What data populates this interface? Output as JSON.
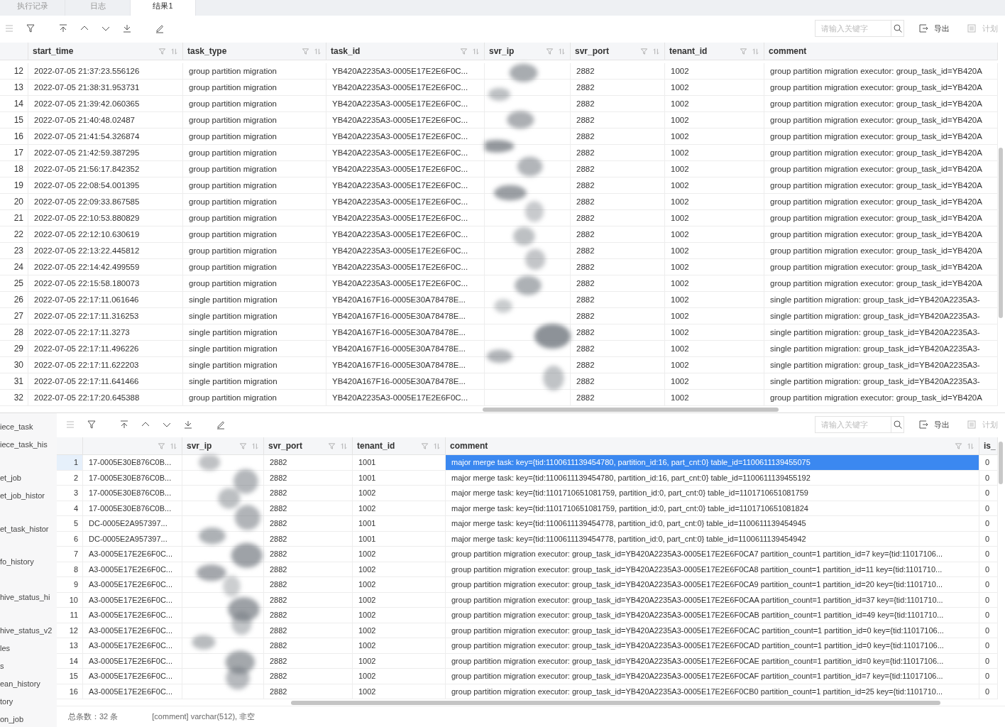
{
  "tabs": [
    {
      "label": "执行记录",
      "selected": false
    },
    {
      "label": "日志",
      "selected": false
    },
    {
      "label": "结果1",
      "selected": true
    }
  ],
  "toolbar": {
    "search_placeholder": "请输入关键字",
    "export_label": "导出",
    "plan_label": "计划",
    "plan_disabled": true
  },
  "result_table": {
    "columns": [
      {
        "label": "start_time",
        "controls": true
      },
      {
        "label": "task_type",
        "controls": true
      },
      {
        "label": "task_id",
        "controls": true
      },
      {
        "label": "svr_ip",
        "controls": true
      },
      {
        "label": "svr_port",
        "controls": true
      },
      {
        "label": "tenant_id",
        "controls": true
      },
      {
        "label": "comment",
        "controls": false
      }
    ],
    "rows": [
      {
        "n": "12",
        "cells": [
          "2022-07-05 21:37:23.556126",
          "group partition migration",
          "YB420A2235A3-0005E17E2E6F0C...",
          "",
          "2882",
          "1002",
          "group partition migration executor: group_task_id=YB420A"
        ]
      },
      {
        "n": "13",
        "cells": [
          "2022-07-05 21:38:31.953731",
          "group partition migration",
          "YB420A2235A3-0005E17E2E6F0C...",
          "",
          "2882",
          "1002",
          "group partition migration executor: group_task_id=YB420A"
        ]
      },
      {
        "n": "14",
        "cells": [
          "2022-07-05 21:39:42.060365",
          "group partition migration",
          "YB420A2235A3-0005E17E2E6F0C...",
          "",
          "2882",
          "1002",
          "group partition migration executor: group_task_id=YB420A"
        ]
      },
      {
        "n": "15",
        "cells": [
          "2022-07-05 21:40:48.02487",
          "group partition migration",
          "YB420A2235A3-0005E17E2E6F0C...",
          "",
          "2882",
          "1002",
          "group partition migration executor: group_task_id=YB420A"
        ]
      },
      {
        "n": "16",
        "cells": [
          "2022-07-05 21:41:54.326874",
          "group partition migration",
          "YB420A2235A3-0005E17E2E6F0C...",
          "",
          "2882",
          "1002",
          "group partition migration executor: group_task_id=YB420A"
        ]
      },
      {
        "n": "17",
        "cells": [
          "2022-07-05 21:42:59.387295",
          "group partition migration",
          "YB420A2235A3-0005E17E2E6F0C...",
          "",
          "2882",
          "1002",
          "group partition migration executor: group_task_id=YB420A"
        ]
      },
      {
        "n": "18",
        "cells": [
          "2022-07-05 21:56:17.842352",
          "group partition migration",
          "YB420A2235A3-0005E17E2E6F0C...",
          "",
          "2882",
          "1002",
          "group partition migration executor: group_task_id=YB420A"
        ]
      },
      {
        "n": "19",
        "cells": [
          "2022-07-05 22:08:54.001395",
          "group partition migration",
          "YB420A2235A3-0005E17E2E6F0C...",
          "",
          "2882",
          "1002",
          "group partition migration executor: group_task_id=YB420A"
        ]
      },
      {
        "n": "20",
        "cells": [
          "2022-07-05 22:09:33.867585",
          "group partition migration",
          "YB420A2235A3-0005E17E2E6F0C...",
          "",
          "2882",
          "1002",
          "group partition migration executor: group_task_id=YB420A"
        ]
      },
      {
        "n": "21",
        "cells": [
          "2022-07-05 22:10:53.880829",
          "group partition migration",
          "YB420A2235A3-0005E17E2E6F0C...",
          "",
          "2882",
          "1002",
          "group partition migration executor: group_task_id=YB420A"
        ]
      },
      {
        "n": "22",
        "cells": [
          "2022-07-05 22:12:10.630619",
          "group partition migration",
          "YB420A2235A3-0005E17E2E6F0C...",
          "",
          "2882",
          "1002",
          "group partition migration executor: group_task_id=YB420A"
        ]
      },
      {
        "n": "23",
        "cells": [
          "2022-07-05 22:13:22.445812",
          "group partition migration",
          "YB420A2235A3-0005E17E2E6F0C...",
          "",
          "2882",
          "1002",
          "group partition migration executor: group_task_id=YB420A"
        ]
      },
      {
        "n": "24",
        "cells": [
          "2022-07-05 22:14:42.499559",
          "group partition migration",
          "YB420A2235A3-0005E17E2E6F0C...",
          "",
          "2882",
          "1002",
          "group partition migration executor: group_task_id=YB420A"
        ]
      },
      {
        "n": "25",
        "cells": [
          "2022-07-05 22:15:58.180073",
          "group partition migration",
          "YB420A2235A3-0005E17E2E6F0C...",
          "",
          "2882",
          "1002",
          "group partition migration executor: group_task_id=YB420A"
        ]
      },
      {
        "n": "26",
        "cells": [
          "2022-07-05 22:17:11.061646",
          "single partition migration",
          "YB420A167F16-0005E30A78478E...",
          "",
          "2882",
          "1002",
          "single partition migration: group_task_id=YB420A2235A3-"
        ]
      },
      {
        "n": "27",
        "cells": [
          "2022-07-05 22:17:11.316253",
          "single partition migration",
          "YB420A167F16-0005E30A78478E...",
          "",
          "2882",
          "1002",
          "single partition migration: group_task_id=YB420A2235A3-"
        ]
      },
      {
        "n": "28",
        "cells": [
          "2022-07-05 22:17:11.3273",
          "single partition migration",
          "YB420A167F16-0005E30A78478E...",
          "",
          "2882",
          "1002",
          "single partition migration: group_task_id=YB420A2235A3-"
        ]
      },
      {
        "n": "29",
        "cells": [
          "2022-07-05 22:17:11.496226",
          "single partition migration",
          "YB420A167F16-0005E30A78478E...",
          "",
          "2882",
          "1002",
          "single partition migration: group_task_id=YB420A2235A3-"
        ]
      },
      {
        "n": "30",
        "cells": [
          "2022-07-05 22:17:11.622203",
          "single partition migration",
          "YB420A167F16-0005E30A78478E...",
          "",
          "2882",
          "1002",
          "single partition migration: group_task_id=YB420A2235A3-"
        ]
      },
      {
        "n": "31",
        "cells": [
          "2022-07-05 22:17:11.641466",
          "single partition migration",
          "YB420A167F16-0005E30A78478E...",
          "",
          "2882",
          "1002",
          "single partition migration: group_task_id=YB420A2235A3-"
        ]
      },
      {
        "n": "32",
        "cells": [
          "2022-07-05 22:17:20.645388",
          "group partition migration",
          "YB420A2235A3-0005E17E2E6F0C...",
          "",
          "2882",
          "1002",
          "group partition migration executor: group_task_id=YB420A"
        ]
      }
    ]
  },
  "sidebar": {
    "items": [
      "iece_task",
      "iece_task_his",
      "et_job",
      "et_job_histor",
      "et_task_histor",
      "fo_history",
      "hive_status_hi",
      "hive_status_v2",
      "les",
      "s",
      "ean_history",
      "tory",
      "on_job"
    ]
  },
  "lower_toolbar": {
    "search_placeholder": "请输入关键字",
    "export_label": "导出",
    "plan_label": "计划",
    "plan_disabled": true
  },
  "lower_table": {
    "columns": [
      {
        "controls": true
      },
      {
        "label": "svr_ip",
        "controls": true
      },
      {
        "label": "svr_port",
        "controls": true
      },
      {
        "label": "tenant_id",
        "controls": true
      },
      {
        "label": "comment",
        "controls": true
      },
      {
        "label": "is_",
        "controls": false
      }
    ],
    "rows": [
      {
        "n": "1",
        "selected": true,
        "cells": [
          "17-0005E30E876C0B...",
          "",
          "2882",
          "1001",
          "major merge task: key={tid:1100611139454780, partition_id:16, part_cnt:0} table_id=1100611139455075",
          "0"
        ]
      },
      {
        "n": "2",
        "selected": false,
        "cells": [
          "17-0005E30E876C0B...",
          "",
          "2882",
          "1001",
          "major merge task: key={tid:1100611139454780, partition_id:16, part_cnt:0} table_id=1100611139455192",
          "0"
        ]
      },
      {
        "n": "3",
        "selected": false,
        "cells": [
          "17-0005E30E876C0B...",
          "",
          "2882",
          "1002",
          "major merge task: key={tid:1101710651081759, partition_id:0, part_cnt:0} table_id=1101710651081759",
          "0"
        ]
      },
      {
        "n": "4",
        "selected": false,
        "cells": [
          "17-0005E30E876C0B...",
          "",
          "2882",
          "1002",
          "major merge task: key={tid:1101710651081759, partition_id:0, part_cnt:0} table_id=1101710651081824",
          "0"
        ]
      },
      {
        "n": "5",
        "selected": false,
        "cells": [
          "DC-0005E2A957397...",
          "",
          "2882",
          "1001",
          "major merge task: key={tid:1100611139454778, partition_id:0, part_cnt:0} table_id=1100611139454945",
          "0"
        ]
      },
      {
        "n": "6",
        "selected": false,
        "cells": [
          "DC-0005E2A957397...",
          "",
          "2882",
          "1001",
          "major merge task: key={tid:1100611139454778, partition_id:0, part_cnt:0} table_id=1100611139454942",
          "0"
        ]
      },
      {
        "n": "7",
        "selected": false,
        "cells": [
          "A3-0005E17E2E6F0C...",
          "",
          "2882",
          "1002",
          "group partition migration executor: group_task_id=YB420A2235A3-0005E17E2E6F0CA7 partition_count=1 partition_id=7 key={tid:11017106...",
          "0"
        ]
      },
      {
        "n": "8",
        "selected": false,
        "cells": [
          "A3-0005E17E2E6F0C...",
          "",
          "2882",
          "1002",
          "group partition migration executor: group_task_id=YB420A2235A3-0005E17E2E6F0CA8 partition_count=1 partition_id=11 key={tid:1101710...",
          "0"
        ]
      },
      {
        "n": "9",
        "selected": false,
        "cells": [
          "A3-0005E17E2E6F0C...",
          "",
          "2882",
          "1002",
          "group partition migration executor: group_task_id=YB420A2235A3-0005E17E2E6F0CA9 partition_count=1 partition_id=20 key={tid:1101710...",
          "0"
        ]
      },
      {
        "n": "10",
        "selected": false,
        "cells": [
          "A3-0005E17E2E6F0C...",
          "",
          "2882",
          "1002",
          "group partition migration executor: group_task_id=YB420A2235A3-0005E17E2E6F0CAA partition_count=1 partition_id=37 key={tid:1101710...",
          "0"
        ]
      },
      {
        "n": "11",
        "selected": false,
        "cells": [
          "A3-0005E17E2E6F0C...",
          "",
          "2882",
          "1002",
          "group partition migration executor: group_task_id=YB420A2235A3-0005E17E2E6F0CAB partition_count=1 partition_id=49 key={tid:1101710...",
          "0"
        ]
      },
      {
        "n": "12",
        "selected": false,
        "cells": [
          "A3-0005E17E2E6F0C...",
          "",
          "2882",
          "1002",
          "group partition migration executor: group_task_id=YB420A2235A3-0005E17E2E6F0CAC partition_count=1 partition_id=0 key={tid:11017106...",
          "0"
        ]
      },
      {
        "n": "13",
        "selected": false,
        "cells": [
          "A3-0005E17E2E6F0C...",
          "",
          "2882",
          "1002",
          "group partition migration executor: group_task_id=YB420A2235A3-0005E17E2E6F0CAD partition_count=1 partition_id=0 key={tid:11017106...",
          "0"
        ]
      },
      {
        "n": "14",
        "selected": false,
        "cells": [
          "A3-0005E17E2E6F0C...",
          "",
          "2882",
          "1002",
          "group partition migration executor: group_task_id=YB420A2235A3-0005E17E2E6F0CAE partition_count=1 partition_id=0 key={tid:11017106...",
          "0"
        ]
      },
      {
        "n": "15",
        "selected": false,
        "cells": [
          "A3-0005E17E2E6F0C...",
          "",
          "2882",
          "1002",
          "group partition migration executor: group_task_id=YB420A2235A3-0005E17E2E6F0CAF partition_count=1 partition_id=7 key={tid:11017106...",
          "0"
        ]
      },
      {
        "n": "16",
        "selected": false,
        "cells": [
          "A3-0005E17E2E6F0C...",
          "",
          "2882",
          "1002",
          "group partition migration executor: group_task_id=YB420A2235A3-0005E17E2E6F0CB0 partition_count=1 partition_id=25 key={tid:1101710...",
          "0"
        ]
      }
    ]
  },
  "status_bar": {
    "total": "总条数：32 条",
    "column_info": "[comment] varchar(512), 非空"
  }
}
